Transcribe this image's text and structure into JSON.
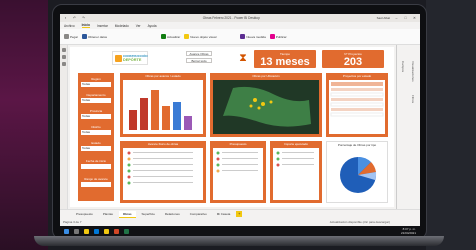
{
  "window": {
    "title": "Obras Febrero 2021 - Power BI Desktop",
    "user": "Saúl Albal"
  },
  "menu": {
    "items": [
      "Archivo",
      "Inicio",
      "Insertar",
      "Modelado",
      "Ver",
      "Ayuda"
    ],
    "active_index": 1
  },
  "ribbon": {
    "buttons": [
      {
        "label": "Pegar",
        "icon": "paste-icon",
        "color": "#8a8886"
      },
      {
        "label": "Obtener datos",
        "icon": "database-icon",
        "color": "#2b579a"
      },
      {
        "label": "Actualizar",
        "icon": "refresh-icon",
        "color": "#107c10"
      },
      {
        "label": "Nuevo objeto visual",
        "icon": "chart-icon",
        "color": "#f2c811"
      },
      {
        "label": "Nueva medida",
        "icon": "calculator-icon",
        "color": "#5c2d91"
      },
      {
        "label": "Publicar",
        "icon": "publish-icon",
        "color": "#e3008c"
      }
    ]
  },
  "header": {
    "logo_line1": "CONSTRUCCIÓN",
    "logo_line2": "DEPÓRTE",
    "btn_obras": "Avance Obras",
    "btn_reset": "Borrar todo",
    "kpi_months": {
      "label": "Tiempo",
      "value": "13 meses"
    },
    "kpi_projects": {
      "label": "N° Proyectos",
      "value": "203"
    }
  },
  "filters": {
    "items": [
      {
        "label": "Region",
        "value": "Todas"
      },
      {
        "label": "Departamento",
        "value": "Todas"
      },
      {
        "label": "Provincia",
        "value": "Todas"
      },
      {
        "label": "Distrito",
        "value": "Todas"
      },
      {
        "label": "Estado",
        "value": "Todas"
      },
      {
        "label": "Fecha de inicio",
        "value": ""
      },
      {
        "label": "Rango de avance",
        "value": ""
      }
    ]
  },
  "panels": {
    "bar_title": "Obras por avance / estado",
    "map_title": "Obras por Ubicación",
    "table_title": "Proyectos por estado",
    "donut_title": "Porcentaje de Obras por tipo",
    "list_title": "Avance físico de obras",
    "list2_title": "Presupuesto",
    "list3_title": "Importe ejecutado"
  },
  "tabs": {
    "items": [
      "Presupuesto",
      "Plantas",
      "Obras",
      "Superficie",
      "Relaciones",
      "Comparativo",
      "Mi Caseta"
    ],
    "active_index": 2
  },
  "status": {
    "left": "Página 3 de 7",
    "right": "Actualización disponible (clic para descargar)"
  },
  "clock": {
    "time": "8:07 p. m.",
    "date": "21/04/2021"
  },
  "colors": {
    "accent": "#e16b2f",
    "map": "#2f6b3a",
    "pie": "#1f5eb8"
  }
}
